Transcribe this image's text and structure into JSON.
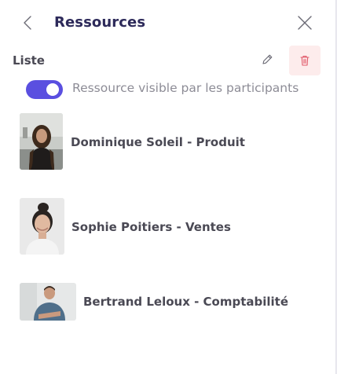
{
  "header": {
    "title": "Ressources",
    "back_icon": "chevron-left-icon",
    "close_icon": "close-icon"
  },
  "list": {
    "label": "Liste",
    "edit_icon": "pencil-icon",
    "delete_icon": "trash-icon"
  },
  "visibility": {
    "label": "Ressource visible par les participants",
    "enabled": true
  },
  "resources": [
    {
      "name": "Dominique Soleil - Produit"
    },
    {
      "name": "Sophie Poitiers - Ventes"
    },
    {
      "name": "Bertrand Leloux - Comptabilité"
    }
  ],
  "colors": {
    "title": "#2d2a5a",
    "accent": "#5a4fe0",
    "danger": "#e15a6a",
    "danger_bg": "#fdecec"
  }
}
